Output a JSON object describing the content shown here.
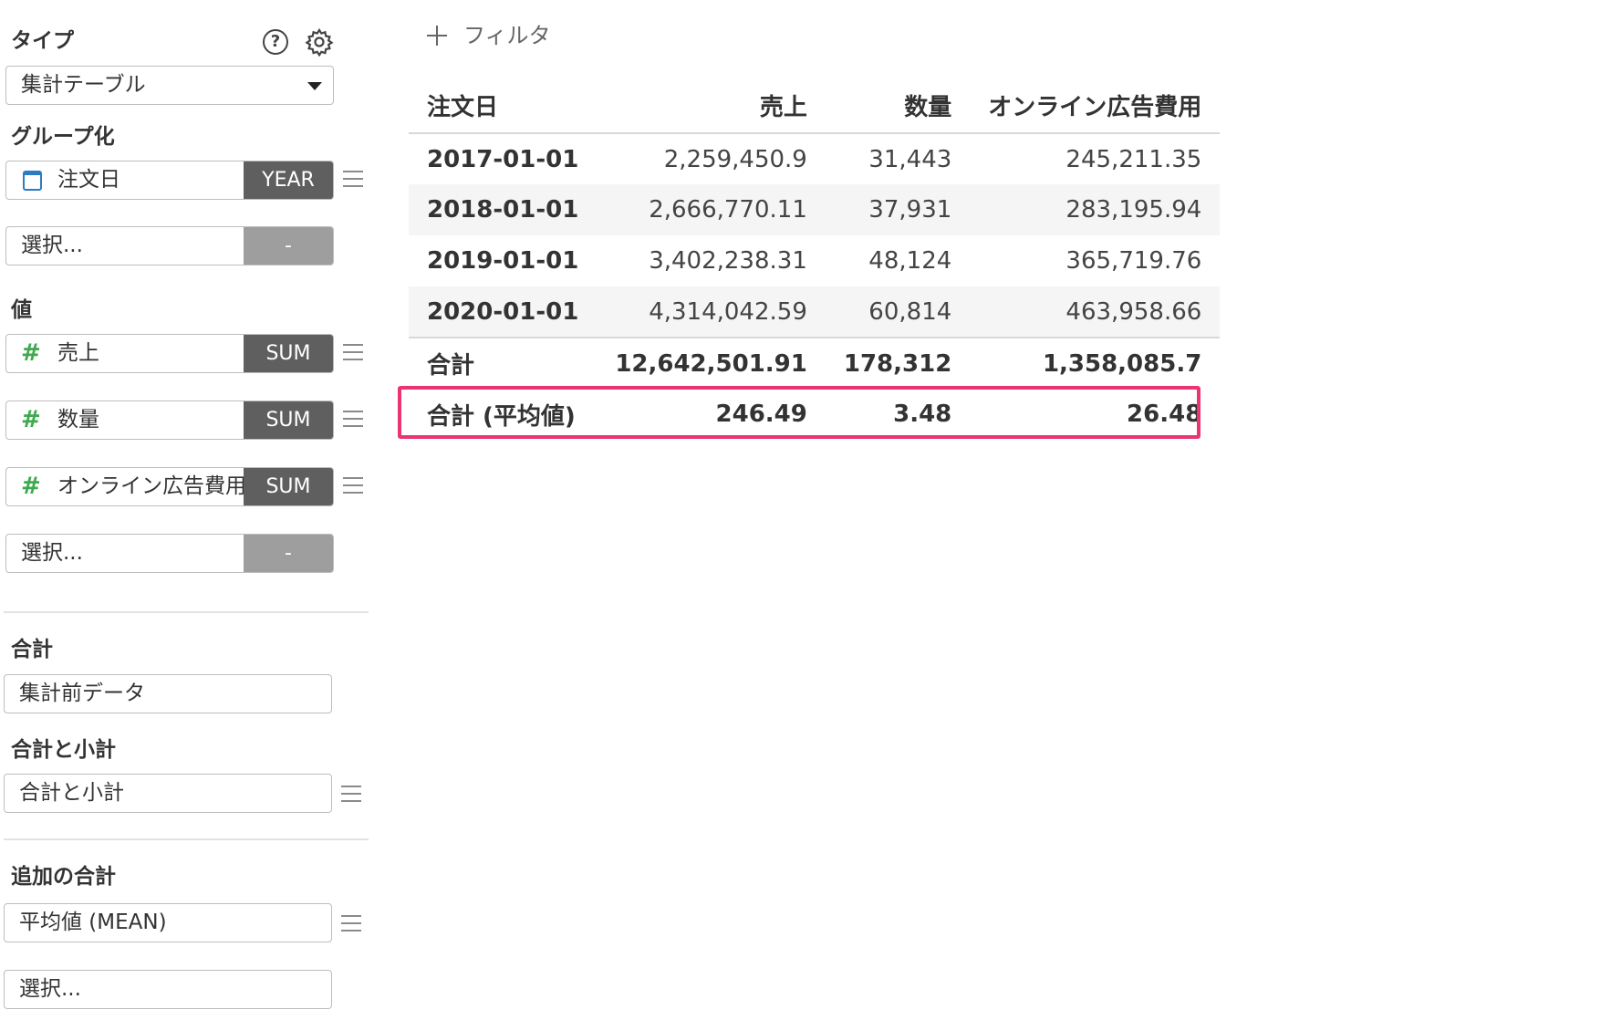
{
  "sidebar": {
    "type_section": {
      "label": "タイプ",
      "help_icon": "?",
      "selected": "集計テーブル"
    },
    "group_section": {
      "label": "グループ化",
      "fields": [
        {
          "icon": "calendar-icon",
          "name": "注文日",
          "agg": "YEAR"
        },
        {
          "icon": "",
          "name": "選択...",
          "agg": "-"
        }
      ]
    },
    "value_section": {
      "label": "値",
      "fields": [
        {
          "icon": "#",
          "name": "売上",
          "agg": "SUM"
        },
        {
          "icon": "#",
          "name": "数量",
          "agg": "SUM"
        },
        {
          "icon": "#",
          "name": "オンライン広告費用",
          "agg": "SUM"
        },
        {
          "icon": "",
          "name": "選択...",
          "agg": "-"
        }
      ]
    },
    "total_section": {
      "label": "合計",
      "value": "集計前データ"
    },
    "subtotal_section": {
      "label": "合計と小計",
      "value": "合計と小計"
    },
    "additional_total_section": {
      "label": "追加の合計",
      "value": "平均値 (MEAN)",
      "placeholder": "選択..."
    }
  },
  "filter": {
    "label": "フィルタ"
  },
  "table": {
    "headers": [
      "注文日",
      "売上",
      "数量",
      "オンライン広告費用"
    ],
    "rows": [
      [
        "2017-01-01",
        "2,259,450.9",
        "31,443",
        "245,211.35"
      ],
      [
        "2018-01-01",
        "2,666,770.11",
        "37,931",
        "283,195.94"
      ],
      [
        "2019-01-01",
        "3,402,238.31",
        "48,124",
        "365,719.76"
      ],
      [
        "2020-01-01",
        "4,314,042.59",
        "60,814",
        "463,958.66"
      ]
    ],
    "total": [
      "合計",
      "12,642,501.91",
      "178,312",
      "1,358,085.7"
    ],
    "mean": [
      "合計 (平均値)",
      "246.49",
      "3.48",
      "26.48"
    ]
  },
  "colors": {
    "highlight": "#ea3572",
    "number_icon": "#3eaa4f",
    "calendar_icon": "#2b7cc4",
    "agg_badge": "#5f5f5f"
  }
}
